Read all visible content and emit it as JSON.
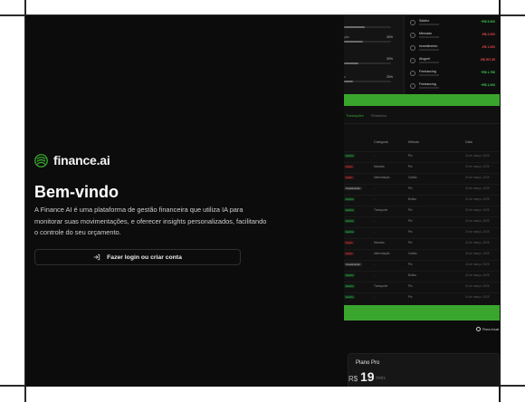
{
  "brand": {
    "name": "finance.ai",
    "logo_icon": "finance-ai-logo-icon",
    "accent": "#3aa52d"
  },
  "hero": {
    "title": "Bem-vindo",
    "description": "A Finance AI é uma plataforma de gestão financeira que utiliza IA para monitorar suas movimentações, e oferecer insights personalizados, facilitando o controle do seu orçamento.",
    "login_label": "Fazer login ou criar conta",
    "login_icon": "log-in-icon"
  },
  "preview": {
    "category_bars": [
      {
        "label": "",
        "percent": "",
        "fill": 0.45
      },
      {
        "label": "ção",
        "percent": "40%",
        "fill": 0.4
      },
      {
        "label": "",
        "percent": "30%",
        "fill": 0.3
      },
      {
        "label": "o",
        "percent": "20%",
        "fill": 0.2
      }
    ],
    "transactions": [
      {
        "name": "Salário",
        "amount": "+R$ 5.000",
        "type": "deposit"
      },
      {
        "name": "Mercado",
        "amount": "-R$ 2.000",
        "type": "expense"
      },
      {
        "name": "Investimento",
        "amount": "-R$ 1.000",
        "type": "expense"
      },
      {
        "name": "Aluguel",
        "amount": "-R$ 507,55",
        "type": "expense"
      },
      {
        "name": "Freelancing",
        "amount": "+R$ 1.750",
        "type": "deposit"
      },
      {
        "name": "Freelancing",
        "amount": "+R$ 1.000",
        "type": "deposit"
      }
    ],
    "tabs": [
      {
        "label": "Transações",
        "active": true
      },
      {
        "label": "Relatórios",
        "active": false
      }
    ],
    "table_headers": {
      "type": "",
      "category": "Categoria",
      "method": "Método",
      "date": "Data"
    },
    "table_rows": [
      {
        "type": "Ganho",
        "kind": "dep",
        "category": "-",
        "method": "Pix",
        "date": "24 de março, 2025"
      },
      {
        "type": "Gasto",
        "kind": "exp",
        "category": "Moradia",
        "method": "Pix",
        "date": "24 de março, 2025"
      },
      {
        "type": "Gasto",
        "kind": "exp",
        "category": "Alimentação",
        "method": "Cartão",
        "date": "24 de março, 2025"
      },
      {
        "type": "Investimento",
        "kind": "inv",
        "category": "-",
        "method": "Pix",
        "date": "24 de março, 2025"
      },
      {
        "type": "Ganho",
        "kind": "dep",
        "category": "-",
        "method": "Boleto",
        "date": "24 de março, 2025"
      },
      {
        "type": "Ganho",
        "kind": "dep",
        "category": "Transporte",
        "method": "Pix",
        "date": "24 de março, 2025"
      },
      {
        "type": "Ganho",
        "kind": "dep",
        "category": "-",
        "method": "Pix",
        "date": "24 de março, 2025"
      },
      {
        "type": "Ganho",
        "kind": "dep",
        "category": "-",
        "method": "Pix",
        "date": "24 de março, 2025"
      },
      {
        "type": "Gasto",
        "kind": "exp",
        "category": "Moradia",
        "method": "Pix",
        "date": "24 de março, 2025"
      },
      {
        "type": "Gasto",
        "kind": "exp",
        "category": "Alimentação",
        "method": "Cartão",
        "date": "24 de março, 2025"
      },
      {
        "type": "Investimento",
        "kind": "inv",
        "category": "-",
        "method": "Pix",
        "date": "24 de março, 2025"
      },
      {
        "type": "Ganho",
        "kind": "dep",
        "category": "-",
        "method": "Boleto",
        "date": "24 de março, 2025"
      },
      {
        "type": "Ganho",
        "kind": "dep",
        "category": "Transporte",
        "method": "Pix",
        "date": "24 de março, 2025"
      },
      {
        "type": "Ganho",
        "kind": "dep",
        "category": "-",
        "method": "Pix",
        "date": "24 de março, 2025"
      }
    ],
    "toggle_label": "Plano Anual",
    "plan": {
      "name": "Plano Pro",
      "currency": "R$",
      "price": "19",
      "period": "/mês"
    },
    "colors": {
      "deposit": "#3ecb52",
      "expense": "#e44a4a",
      "green": "#3aa52d"
    }
  }
}
